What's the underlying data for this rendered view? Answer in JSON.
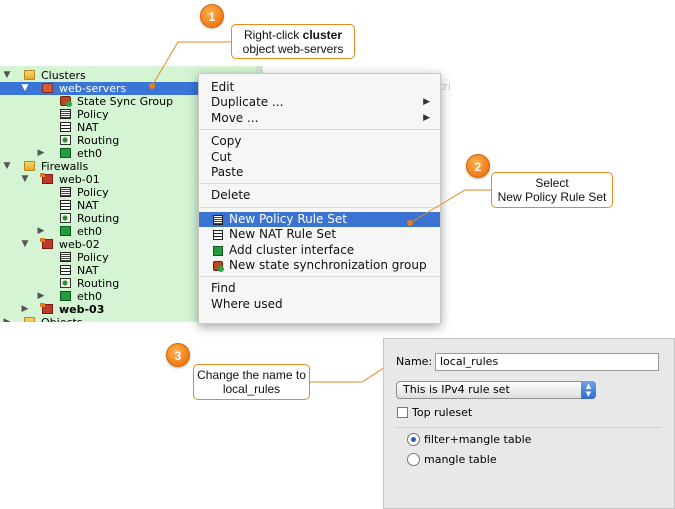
{
  "tree": {
    "items": [
      {
        "label": "Clusters",
        "twisty": "▼",
        "icon": "folder-icon",
        "depth": 0,
        "selected": false,
        "bold": false
      },
      {
        "label": "web-servers",
        "twisty": "▼",
        "icon": "cluster-icon",
        "depth": 1,
        "selected": true,
        "bold": false
      },
      {
        "label": "State Sync Group",
        "twisty": "",
        "icon": "state-sync-group-icon",
        "depth": 2,
        "selected": false,
        "bold": false
      },
      {
        "label": "Policy",
        "twisty": "",
        "icon": "policy-icon",
        "depth": 2,
        "selected": false,
        "bold": false
      },
      {
        "label": "NAT",
        "twisty": "",
        "icon": "nat-icon",
        "depth": 2,
        "selected": false,
        "bold": false
      },
      {
        "label": "Routing",
        "twisty": "",
        "icon": "routing-icon",
        "depth": 2,
        "selected": false,
        "bold": false
      },
      {
        "label": "eth0",
        "twisty": "▶",
        "icon": "interface-icon",
        "depth": 2,
        "selected": false,
        "bold": false
      },
      {
        "label": "Firewalls",
        "twisty": "▼",
        "icon": "folder-icon",
        "depth": 0,
        "selected": false,
        "bold": false
      },
      {
        "label": "web-01",
        "twisty": "▼",
        "icon": "firewall-icon",
        "depth": 1,
        "selected": false,
        "bold": false
      },
      {
        "label": "Policy",
        "twisty": "",
        "icon": "policy-icon",
        "depth": 2,
        "selected": false,
        "bold": false
      },
      {
        "label": "NAT",
        "twisty": "",
        "icon": "nat-icon",
        "depth": 2,
        "selected": false,
        "bold": false
      },
      {
        "label": "Routing",
        "twisty": "",
        "icon": "routing-icon",
        "depth": 2,
        "selected": false,
        "bold": false
      },
      {
        "label": "eth0",
        "twisty": "▶",
        "icon": "interface-icon",
        "depth": 2,
        "selected": false,
        "bold": false
      },
      {
        "label": "web-02",
        "twisty": "▼",
        "icon": "firewall-icon",
        "depth": 1,
        "selected": false,
        "bold": false
      },
      {
        "label": "Policy",
        "twisty": "",
        "icon": "policy-icon",
        "depth": 2,
        "selected": false,
        "bold": false
      },
      {
        "label": "NAT",
        "twisty": "",
        "icon": "nat-icon",
        "depth": 2,
        "selected": false,
        "bold": false
      },
      {
        "label": "Routing",
        "twisty": "",
        "icon": "routing-icon",
        "depth": 2,
        "selected": false,
        "bold": false
      },
      {
        "label": "eth0",
        "twisty": "▶",
        "icon": "interface-icon",
        "depth": 2,
        "selected": false,
        "bold": false
      },
      {
        "label": "web-03",
        "twisty": "▶",
        "icon": "firewall-icon",
        "depth": 1,
        "selected": false,
        "bold": true
      },
      {
        "label": "Objects",
        "twisty": "▶",
        "icon": "folder-icon",
        "depth": 0,
        "selected": false,
        "bold": false
      }
    ]
  },
  "background": {
    "ghost_text": "tri"
  },
  "context_menu": {
    "items": [
      {
        "label": "Edit",
        "submenu": false,
        "icon": "",
        "highlighted": false
      },
      {
        "label": "Duplicate ...",
        "submenu": true,
        "icon": "",
        "highlighted": false
      },
      {
        "label": "Move ...",
        "submenu": true,
        "icon": "",
        "highlighted": false
      },
      {
        "separator": true
      },
      {
        "label": "Copy",
        "submenu": false,
        "icon": "",
        "highlighted": false
      },
      {
        "label": "Cut",
        "submenu": false,
        "icon": "",
        "highlighted": false
      },
      {
        "label": "Paste",
        "submenu": false,
        "icon": "",
        "highlighted": false
      },
      {
        "separator": true
      },
      {
        "label": "Delete",
        "submenu": false,
        "icon": "",
        "highlighted": false
      },
      {
        "separator": true
      },
      {
        "label": "New Policy Rule Set",
        "submenu": false,
        "icon": "policy-icon",
        "highlighted": true
      },
      {
        "label": "New NAT Rule Set",
        "submenu": false,
        "icon": "nat-icon",
        "highlighted": false
      },
      {
        "label": "Add cluster interface",
        "submenu": false,
        "icon": "interface-icon",
        "highlighted": false
      },
      {
        "label": "New state synchronization group",
        "submenu": false,
        "icon": "state-sync-group-icon",
        "highlighted": false
      },
      {
        "separator": true
      },
      {
        "label": "Find",
        "submenu": false,
        "icon": "",
        "highlighted": false
      },
      {
        "label": "Where used",
        "submenu": false,
        "icon": "",
        "highlighted": false
      }
    ],
    "submenu_arrow": "▶"
  },
  "callouts": [
    {
      "number": "1",
      "pre": "Right-click ",
      "bold": "cluster",
      "rest": "object web-servers"
    },
    {
      "number": "2",
      "line1": "Select",
      "line2": "New Policy Rule Set"
    },
    {
      "number": "3",
      "line1": "Change the name to",
      "line2": "local_rules"
    }
  ],
  "dialog": {
    "name_label": "Name:",
    "name_value": "local_rules",
    "ip_select": "This is IPv4 rule set",
    "stepper": "▲▼",
    "top_ruleset_label": "Top ruleset",
    "top_ruleset_checked": false,
    "radio_options": [
      {
        "label": "filter+mangle table",
        "selected": true
      },
      {
        "label": "mangle table",
        "selected": false
      }
    ]
  },
  "colors": {
    "tree_background": "#d4f4d4",
    "selection": "#3875d7",
    "menu_highlight": "#3b73d3",
    "callout_accent": "#f07c12"
  }
}
